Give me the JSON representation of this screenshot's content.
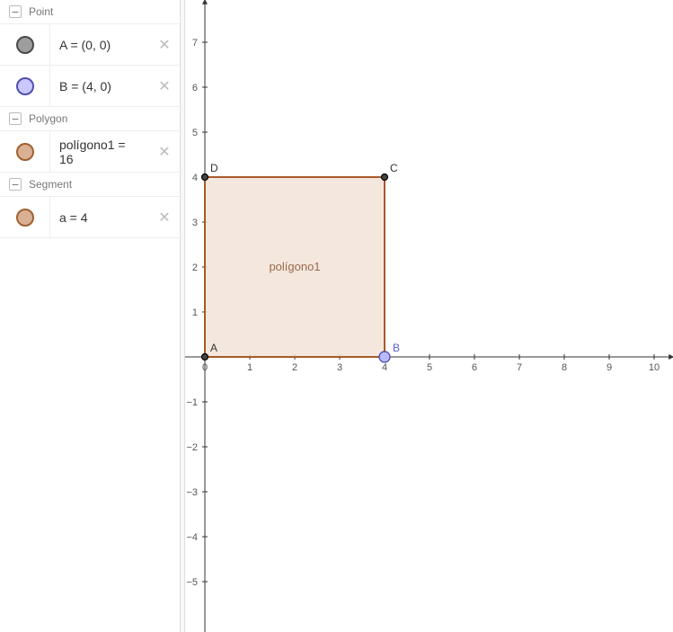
{
  "sidebar": {
    "groups": [
      {
        "title": "Point",
        "items": [
          {
            "swatch_fill": "#9d9d9d",
            "swatch_stroke": "#4a4a4a",
            "label": "A = (0, 0)"
          },
          {
            "swatch_fill": "#c8c8ff",
            "swatch_stroke": "#5050b0",
            "label": "B = (4, 0)"
          }
        ]
      },
      {
        "title": "Polygon",
        "items": [
          {
            "swatch_fill": "#d9b094",
            "swatch_stroke": "#a06030",
            "label": "polígono1 = 16"
          }
        ]
      },
      {
        "title": "Segment",
        "items": [
          {
            "swatch_fill": "#d9b094",
            "swatch_stroke": "#a06030",
            "label": "a = 4"
          }
        ]
      }
    ]
  },
  "chart_data": {
    "type": "scatter",
    "title": "",
    "xlabel": "",
    "ylabel": "",
    "xlim": [
      0,
      10
    ],
    "ylim": [
      -5,
      7
    ],
    "x_ticks": [
      0,
      1,
      2,
      3,
      4,
      5,
      6,
      7,
      8,
      9,
      10
    ],
    "y_ticks": [
      -5,
      -4,
      -3,
      -2,
      -1,
      1,
      2,
      3,
      4,
      5,
      6,
      7
    ],
    "points": [
      {
        "name": "A",
        "x": 0,
        "y": 0
      },
      {
        "name": "B",
        "x": 4,
        "y": 0
      },
      {
        "name": "C",
        "x": 4,
        "y": 4
      },
      {
        "name": "D",
        "x": 0,
        "y": 4
      }
    ],
    "polygon": {
      "name": "polígono1",
      "area": 16,
      "vertices": [
        [
          0,
          0
        ],
        [
          4,
          0
        ],
        [
          4,
          4
        ],
        [
          0,
          4
        ]
      ]
    },
    "segments": [
      {
        "name": "a",
        "length": 4,
        "from": [
          0,
          0
        ],
        "to": [
          4,
          0
        ]
      }
    ]
  },
  "graph_labels": {
    "A": "A",
    "B": "B",
    "C": "C",
    "D": "D",
    "poly": "polígono1"
  }
}
